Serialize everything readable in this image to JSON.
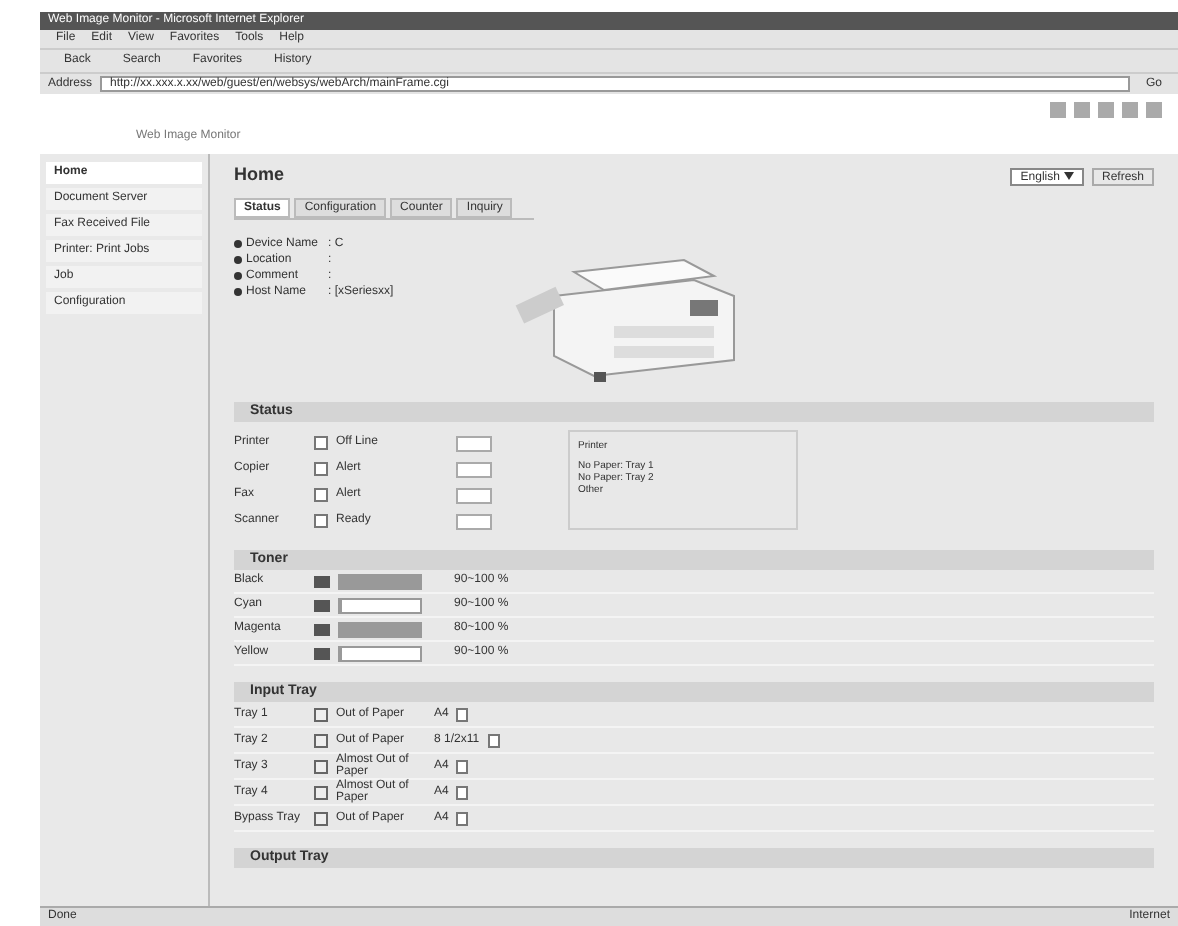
{
  "window": {
    "title": "Web Image Monitor - Microsoft Internet Explorer"
  },
  "menu": [
    "File",
    "Edit",
    "View",
    "Favorites",
    "Tools",
    "Help"
  ],
  "toolbar": [
    "Back",
    "Search",
    "Favorites",
    "History"
  ],
  "address": {
    "label": "Address",
    "url": "http://xx.xxx.x.xx/web/guest/en/websys/webArch/mainFrame.cgi",
    "go": "Go"
  },
  "header": {
    "product": "Web Image Monitor"
  },
  "sidebar": {
    "items": [
      {
        "label": "Home",
        "selected": true
      },
      {
        "label": "Document Server",
        "selected": false
      },
      {
        "label": "Fax Received File",
        "selected": false
      },
      {
        "label": "Printer: Print Jobs",
        "selected": false
      },
      {
        "label": "Job",
        "selected": false
      },
      {
        "label": "Configuration",
        "selected": false
      }
    ]
  },
  "page": {
    "title": "Home",
    "language": "English",
    "refresh": "Refresh"
  },
  "tabs": [
    {
      "label": "Status",
      "selected": true
    },
    {
      "label": "Configuration",
      "selected": false
    },
    {
      "label": "Counter",
      "selected": false
    },
    {
      "label": "Inquiry",
      "selected": false
    }
  ],
  "info": [
    {
      "label": "Device Name",
      "value": ": C"
    },
    {
      "label": "Location",
      "value": ":"
    },
    {
      "label": "Comment",
      "value": ":"
    },
    {
      "label": "Host Name",
      "value": ": [xSeriesxx]"
    }
  ],
  "status": {
    "title": "Status",
    "rows": [
      {
        "name": "Printer",
        "state": "Off Line"
      },
      {
        "name": "Copier",
        "state": "Alert"
      },
      {
        "name": "Fax",
        "state": "Alert"
      },
      {
        "name": "Scanner",
        "state": "Ready"
      }
    ],
    "messages": [
      "Printer",
      "No Paper: Tray 1",
      "No Paper: Tray 2",
      "Other"
    ]
  },
  "toner": {
    "title": "Toner",
    "rows": [
      {
        "name": "Black",
        "level": 1,
        "reading": "90~100 %"
      },
      {
        "name": "Cyan",
        "level": 0,
        "reading": "90~100 %"
      },
      {
        "name": "Magenta",
        "level": 1,
        "reading": "80~100 %"
      },
      {
        "name": "Yellow",
        "level": 0,
        "reading": "90~100 %"
      }
    ]
  },
  "input_tray": {
    "title": "Input Tray",
    "rows": [
      {
        "name": "Tray 1",
        "state": "Out of Paper",
        "size": "A4"
      },
      {
        "name": "Tray 2",
        "state": "Out of Paper",
        "size": "8 1/2x11"
      },
      {
        "name": "Tray 3",
        "state": "Almost Out of Paper",
        "size": "A4"
      },
      {
        "name": "Tray 4",
        "state": "Almost Out of Paper",
        "size": "A4"
      },
      {
        "name": "Bypass Tray",
        "state": "Out of Paper",
        "size": "A4"
      }
    ]
  },
  "output_tray": {
    "title": "Output Tray"
  },
  "status_bar": {
    "left": "Done",
    "zone": "Internet"
  }
}
